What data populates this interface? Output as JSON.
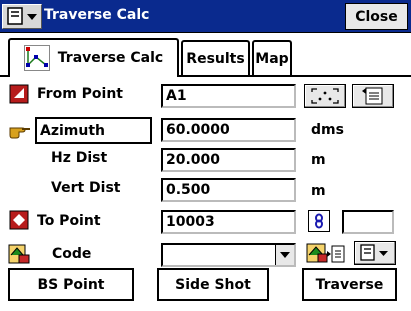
{
  "titlebar": {
    "title": "Traverse Calc",
    "close_label": "Close"
  },
  "tabs": [
    {
      "label": "Traverse Calc"
    },
    {
      "label": "Results"
    },
    {
      "label": "Map"
    }
  ],
  "form": {
    "from_point": {
      "label": "From Point",
      "value": "A1"
    },
    "azimuth": {
      "label": "Azimuth",
      "value": "60.0000",
      "unit": "dms"
    },
    "hz_dist": {
      "label": "Hz Dist",
      "value": "20.000",
      "unit": "m"
    },
    "vert_dist": {
      "label": "Vert Dist",
      "value": "0.500",
      "unit": "m"
    },
    "to_point": {
      "label": "To Point",
      "value": "10003",
      "extra_value": ""
    },
    "code": {
      "label": "Code",
      "value": ""
    }
  },
  "buttons": {
    "bs_point": "BS Point",
    "side_shot": "Side Shot",
    "traverse": "Traverse"
  }
}
